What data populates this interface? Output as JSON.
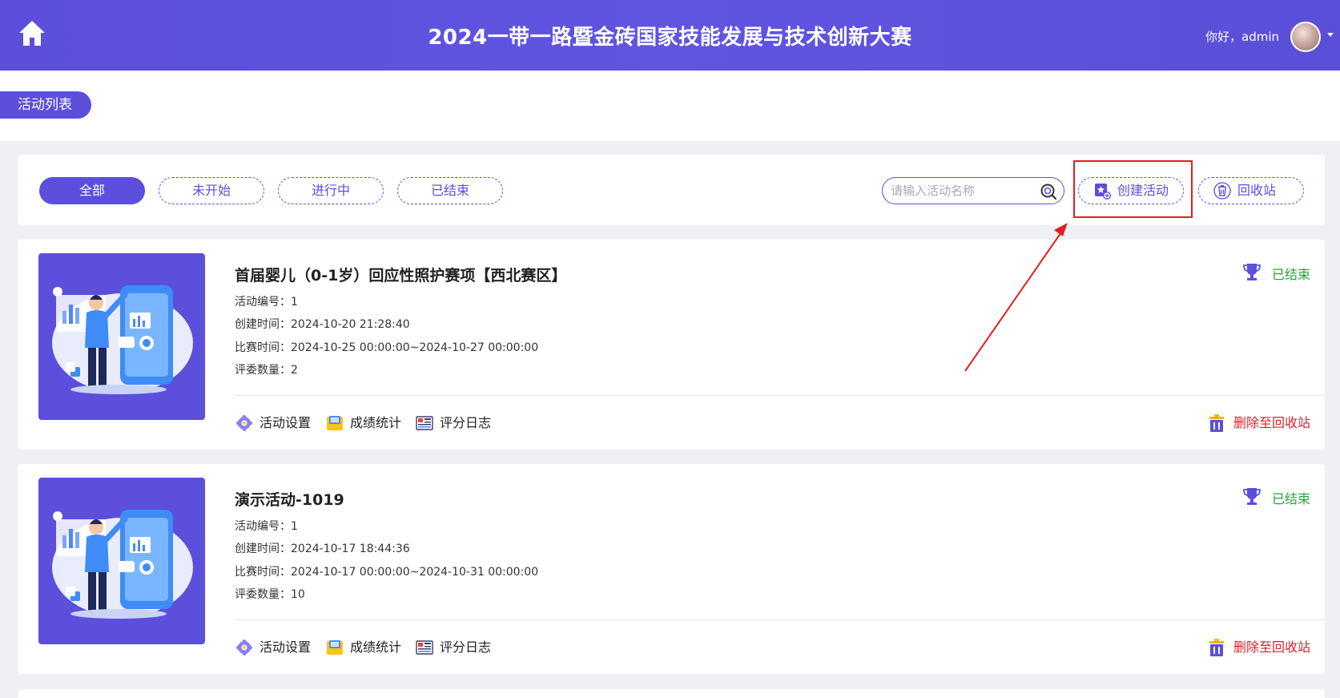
{
  "header": {
    "title": "2024一带一路暨金砖国家技能发展与技术创新大赛",
    "greeting": "你好，admin"
  },
  "breadcrumb": {
    "label": "活动列表"
  },
  "filters": {
    "tabs": [
      {
        "label": "全部",
        "active": true
      },
      {
        "label": "未开始",
        "active": false
      },
      {
        "label": "进行中",
        "active": false
      },
      {
        "label": "已结束",
        "active": false
      }
    ],
    "search_placeholder": "请输入活动名称",
    "create_label": "创建活动",
    "recycle_label": "回收站"
  },
  "activities": [
    {
      "title": "首届婴儿（0-1岁）回应性照护赛项【西北赛区】",
      "status": "已结束",
      "number_label": "活动编号：",
      "number": "1",
      "created_label": "创建时间：",
      "created": "2024-10-20 21:28:40",
      "period_label": "比赛时间：",
      "period": "2024-10-25 00:00:00~2024-10-27 00:00:00",
      "judges_label": "评委数量：",
      "judges": "2",
      "actions": [
        "活动设置",
        "成绩统计",
        "评分日志"
      ],
      "delete_label": "删除至回收站"
    },
    {
      "title": "演示活动-1019",
      "status": "已结束",
      "number_label": "活动编号：",
      "number": "1",
      "created_label": "创建时间：",
      "created": "2024-10-17 18:44:36",
      "period_label": "比赛时间：",
      "period": "2024-10-17 00:00:00~2024-10-31 00:00:00",
      "judges_label": "评委数量：",
      "judges": "10",
      "actions": [
        "活动设置",
        "成绩统计",
        "评分日志"
      ],
      "delete_label": "删除至回收站"
    }
  ],
  "icons": {
    "home": "home-icon",
    "search": "search-icon",
    "create": "create-activity-icon",
    "recycle": "recycle-bin-icon",
    "status": "trophy-icon",
    "settings": "gear-icon",
    "stats": "score-stats-icon",
    "log": "score-log-icon",
    "delete": "trash-icon"
  },
  "colors": {
    "primary": "#5b4fdc",
    "status_ended": "#2aa13c",
    "danger": "#d4242b",
    "annotation": "#e0201f"
  }
}
